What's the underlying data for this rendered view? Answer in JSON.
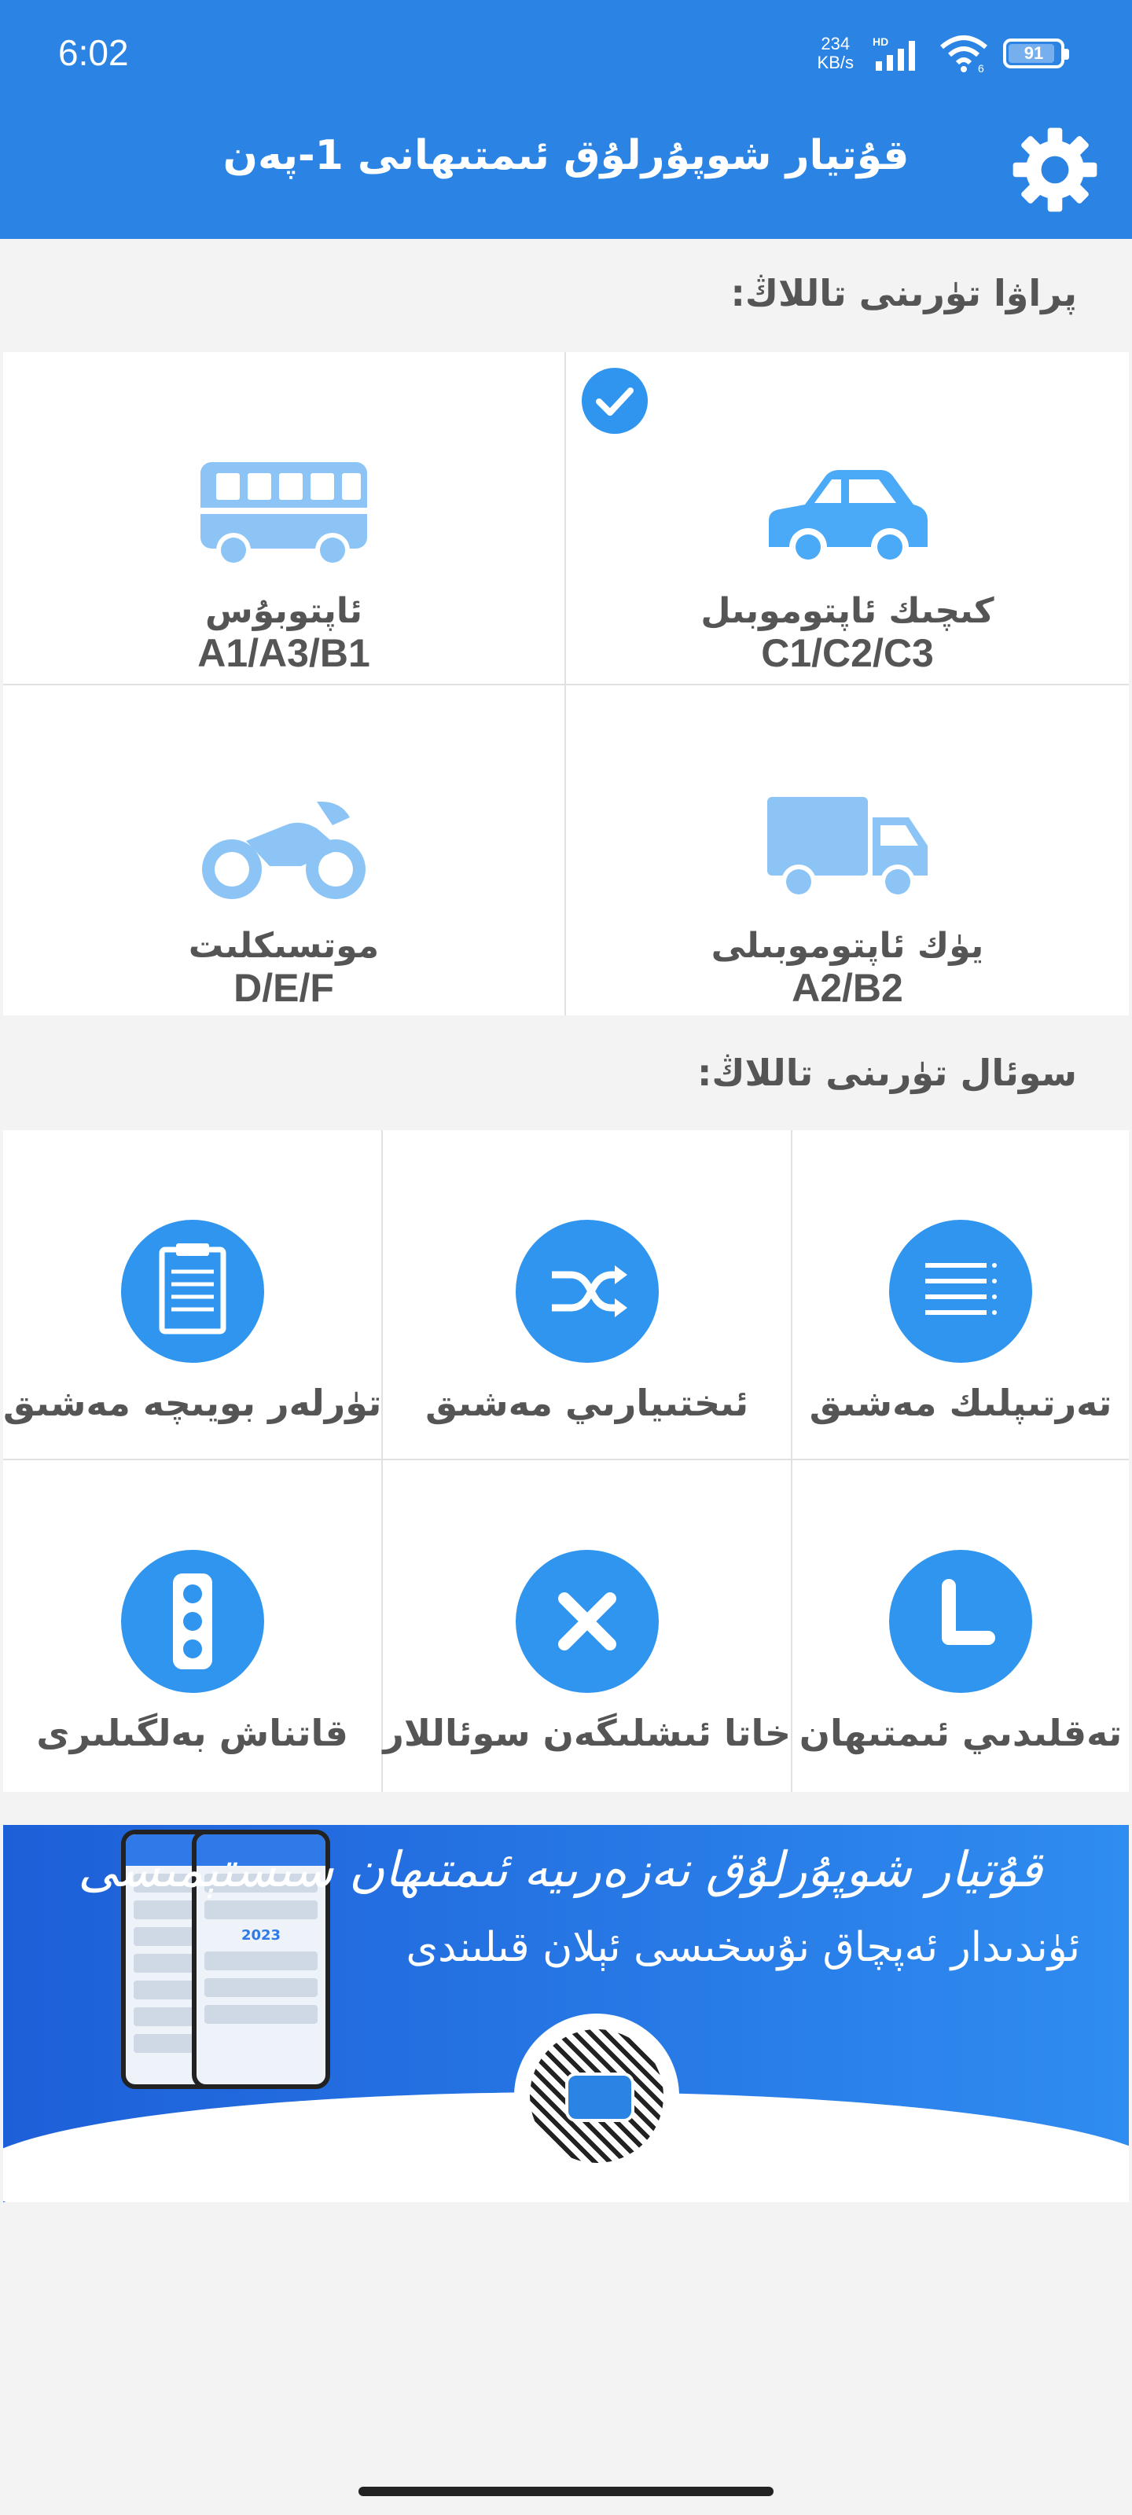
{
  "status_bar": {
    "time": "6:02",
    "speed_value": "234",
    "speed_unit": "KB/s",
    "network": "HD",
    "wifi_badge": "6",
    "battery": "91"
  },
  "header": {
    "title": "قۇتيار شوپۇرلۇق ئىمتىھانى 1-پەن",
    "settings_icon": "gear-icon"
  },
  "vehicle_section": {
    "title": "پراۋا تۈرىنى تاللاڭ:",
    "items": [
      {
        "name": "كىچىك ئاپتوموبىل",
        "code": "C1/C2/C3",
        "icon": "car-icon",
        "selected": true
      },
      {
        "name": "ئاپتوبۇس",
        "code": "A1/A3/B1",
        "icon": "bus-icon",
        "selected": false
      },
      {
        "name": "يۈك ئاپتوموبىلى",
        "code": "A2/B2",
        "icon": "truck-icon",
        "selected": false
      },
      {
        "name": "موتسىكلىت",
        "code": "D/E/F",
        "icon": "motorcycle-icon",
        "selected": false
      }
    ]
  },
  "question_section": {
    "title": "سوئال تۈرىنى تاللاڭ:",
    "items": [
      {
        "label": "تەرتىپلىك مەشىق",
        "icon": "list-icon"
      },
      {
        "label": "ئىختىيارىي مەشىق",
        "icon": "shuffle-icon"
      },
      {
        "label": "تۈرلەر بويىچە مەشىق",
        "icon": "clipboard-icon"
      },
      {
        "label": "تەقلىدىي ئىمتىھان",
        "icon": "clock-icon"
      },
      {
        "label": "خاتا ئىشلىگەن سوئاللار",
        "icon": "close-icon"
      },
      {
        "label": "قاتناش بەلگىلىرى",
        "icon": "traffic-light-icon"
      }
    ]
  },
  "banner": {
    "line1": "قۇتيار شوپۇرلۇق نەزەرىيە ئىمتىھان سىستېمىسى",
    "line2": "ئۈندىدار ئەپچاق نۇسخىسى ئېلان قىلىندى",
    "phone_caption": "2023"
  },
  "colors": {
    "primary": "#2b84e4",
    "icon_light": "#8cc4f5",
    "icon_circle": "#2f95ef",
    "text": "#555555"
  }
}
